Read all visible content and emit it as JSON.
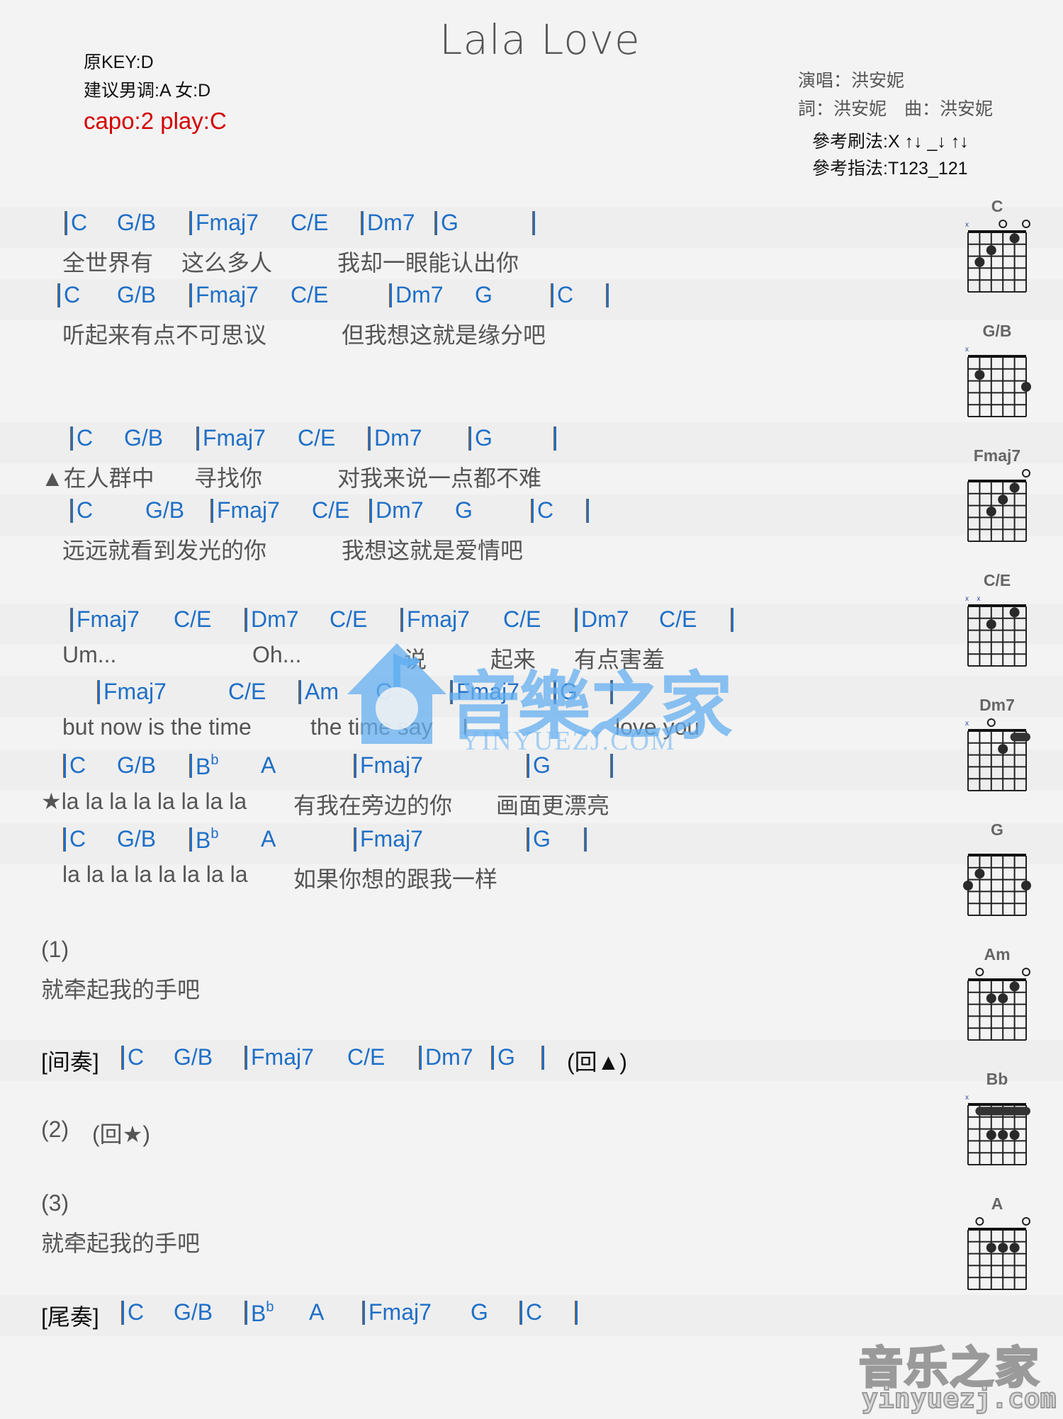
{
  "title": "Lala Love",
  "meta_left": {
    "original_key": "原KEY:D",
    "suggested_key": "建议男调:A 女:D",
    "capo": "capo:2 play:C"
  },
  "meta_right": {
    "singer": "演唱：洪安妮",
    "credits": "詞：洪安妮　曲：洪安妮",
    "strum": "參考刷法:X ↑↓ _↓ ↑↓",
    "finger": "參考指法:T123_121"
  },
  "colors": {
    "chord": "#1f6fc7",
    "lyric": "#555555",
    "capo": "#d40000",
    "bar_shadow": "#a85f1a"
  },
  "chord_lines": [
    {
      "tokens": [
        "|",
        "C",
        "G/B",
        "|",
        "Fmaj7",
        "C/E",
        "|",
        "Dm7",
        "|",
        "G",
        "|"
      ]
    },
    {
      "tokens": [
        "|",
        "C",
        "G/B",
        "|",
        "Fmaj7",
        "C/E",
        "|",
        "Dm7",
        "G",
        "|",
        "C",
        "|"
      ]
    },
    {
      "tokens": [
        "|",
        "C",
        "G/B",
        "|",
        "Fmaj7",
        "C/E",
        "|",
        "Dm7",
        "|",
        "G",
        "|"
      ]
    },
    {
      "tokens": [
        "|",
        "C",
        "G/B",
        "|",
        "Fmaj7",
        "C/E",
        "|",
        "Dm7",
        "G",
        "|",
        "C",
        "|"
      ]
    },
    {
      "tokens": [
        "|",
        "Fmaj7",
        "C/E",
        "|",
        "Dm7",
        "C/E",
        "|",
        "Fmaj7",
        "C/E",
        "|",
        "Dm7",
        "C/E",
        "|"
      ]
    },
    {
      "tokens": [
        "|",
        "Fmaj7",
        "C/E",
        "|",
        "Am",
        "C",
        "|",
        "Fmaj7",
        "|",
        "G",
        "|"
      ]
    },
    {
      "tokens": [
        "|",
        "C",
        "G/B",
        "|",
        "Bb",
        "A",
        "|",
        "Fmaj7",
        "|",
        "G",
        "|"
      ]
    },
    {
      "tokens": [
        "|",
        "C",
        "G/B",
        "|",
        "Bb",
        "A",
        "|",
        "Fmaj7",
        "|",
        "G",
        "|"
      ]
    }
  ],
  "lyric_lines": [
    {
      "segments": [
        "全世界有",
        "这么多人",
        "我却一眼能认出你"
      ]
    },
    {
      "segments": [
        "听起来有点不可思议",
        "但我想这就是缘分吧"
      ]
    },
    {
      "segments": [
        "▲在人群中",
        "寻找你",
        "对我来说一点都不难"
      ]
    },
    {
      "segments": [
        "远远就看到发光的你",
        "我想这就是爱情吧"
      ]
    },
    {
      "segments": [
        "Um...",
        "Oh...",
        "说",
        "起来",
        "有点害羞"
      ]
    },
    {
      "segments": [
        "but now is the time",
        "the time say",
        "I",
        "love you"
      ]
    },
    {
      "segments": [
        "★la la la la la la la la",
        "有我在旁边的你",
        "画面更漂亮"
      ]
    },
    {
      "segments": [
        "la la la la la la la la",
        "如果你想的跟我一样"
      ]
    }
  ],
  "sections": {
    "part1_label": "(1)",
    "part1_lyric": "就牵起我的手吧",
    "interlude_label": "[间奏]",
    "interlude_tokens": [
      "|",
      "C",
      "G/B",
      "|",
      "Fmaj7",
      "C/E",
      "|",
      "Dm7",
      "|",
      "G",
      "|"
    ],
    "interlude_repeat": "(回▲)",
    "part2_label": "(2)",
    "part2_repeat": "(回★)",
    "part3_label": "(3)",
    "part3_lyric": "就牵起我的手吧",
    "outro_label": "[尾奏]",
    "outro_tokens": [
      "|",
      "C",
      "G/B",
      "|",
      "Bb",
      "A",
      "|",
      "Fmaj7",
      "G",
      "|",
      "C",
      "|"
    ]
  },
  "chord_diagrams": [
    {
      "name": "C",
      "strings": [
        "x",
        "",
        "",
        "o",
        "",
        "o"
      ],
      "dots": [
        [
          5,
          3
        ],
        [
          4,
          2
        ],
        [
          2,
          1
        ]
      ],
      "barre": null
    },
    {
      "name": "G/B",
      "strings": [
        "x",
        "",
        "",
        "",
        "",
        ""
      ],
      "dots": [
        [
          5,
          2
        ],
        [
          1,
          3
        ]
      ],
      "barre": null
    },
    {
      "name": "Fmaj7",
      "strings": [
        "",
        "",
        "",
        "",
        "",
        "o"
      ],
      "dots": [
        [
          4,
          3
        ],
        [
          3,
          2
        ],
        [
          2,
          1
        ]
      ],
      "barre": null
    },
    {
      "name": "C/E",
      "strings": [
        "x",
        "x",
        "",
        "",
        "",
        ""
      ],
      "dots": [
        [
          4,
          2
        ],
        [
          2,
          1
        ]
      ],
      "barre": null
    },
    {
      "name": "Dm7",
      "strings": [
        "x",
        "",
        "o",
        "",
        "",
        ""
      ],
      "dots": [
        [
          3,
          2
        ]
      ],
      "barre": {
        "fret": 1,
        "from": 2,
        "to": 1
      }
    },
    {
      "name": "G",
      "strings": [
        "",
        "",
        "",
        "",
        "",
        ""
      ],
      "dots": [
        [
          6,
          3
        ],
        [
          5,
          2
        ],
        [
          1,
          3
        ]
      ],
      "barre": null
    },
    {
      "name": "Am",
      "strings": [
        "",
        "o",
        "",
        "",
        "",
        "o"
      ],
      "dots": [
        [
          4,
          2
        ],
        [
          3,
          2
        ],
        [
          2,
          1
        ]
      ],
      "barre": null
    },
    {
      "name": "Bb",
      "strings": [
        "x",
        "",
        "",
        "",
        "",
        ""
      ],
      "dots": [
        [
          4,
          3
        ],
        [
          3,
          3
        ],
        [
          2,
          3
        ]
      ],
      "barre": {
        "fret": 1,
        "from": 5,
        "to": 1
      }
    },
    {
      "name": "A",
      "strings": [
        "",
        "o",
        "",
        "",
        "",
        "o"
      ],
      "dots": [
        [
          4,
          2
        ],
        [
          3,
          2
        ],
        [
          2,
          2
        ]
      ],
      "barre": null
    }
  ],
  "watermark": {
    "center_main": "音樂之家",
    "center_sub": "YINYUEZJ.COM",
    "corner_main": "音乐之家",
    "corner_sub": "yinyuezj.com"
  }
}
